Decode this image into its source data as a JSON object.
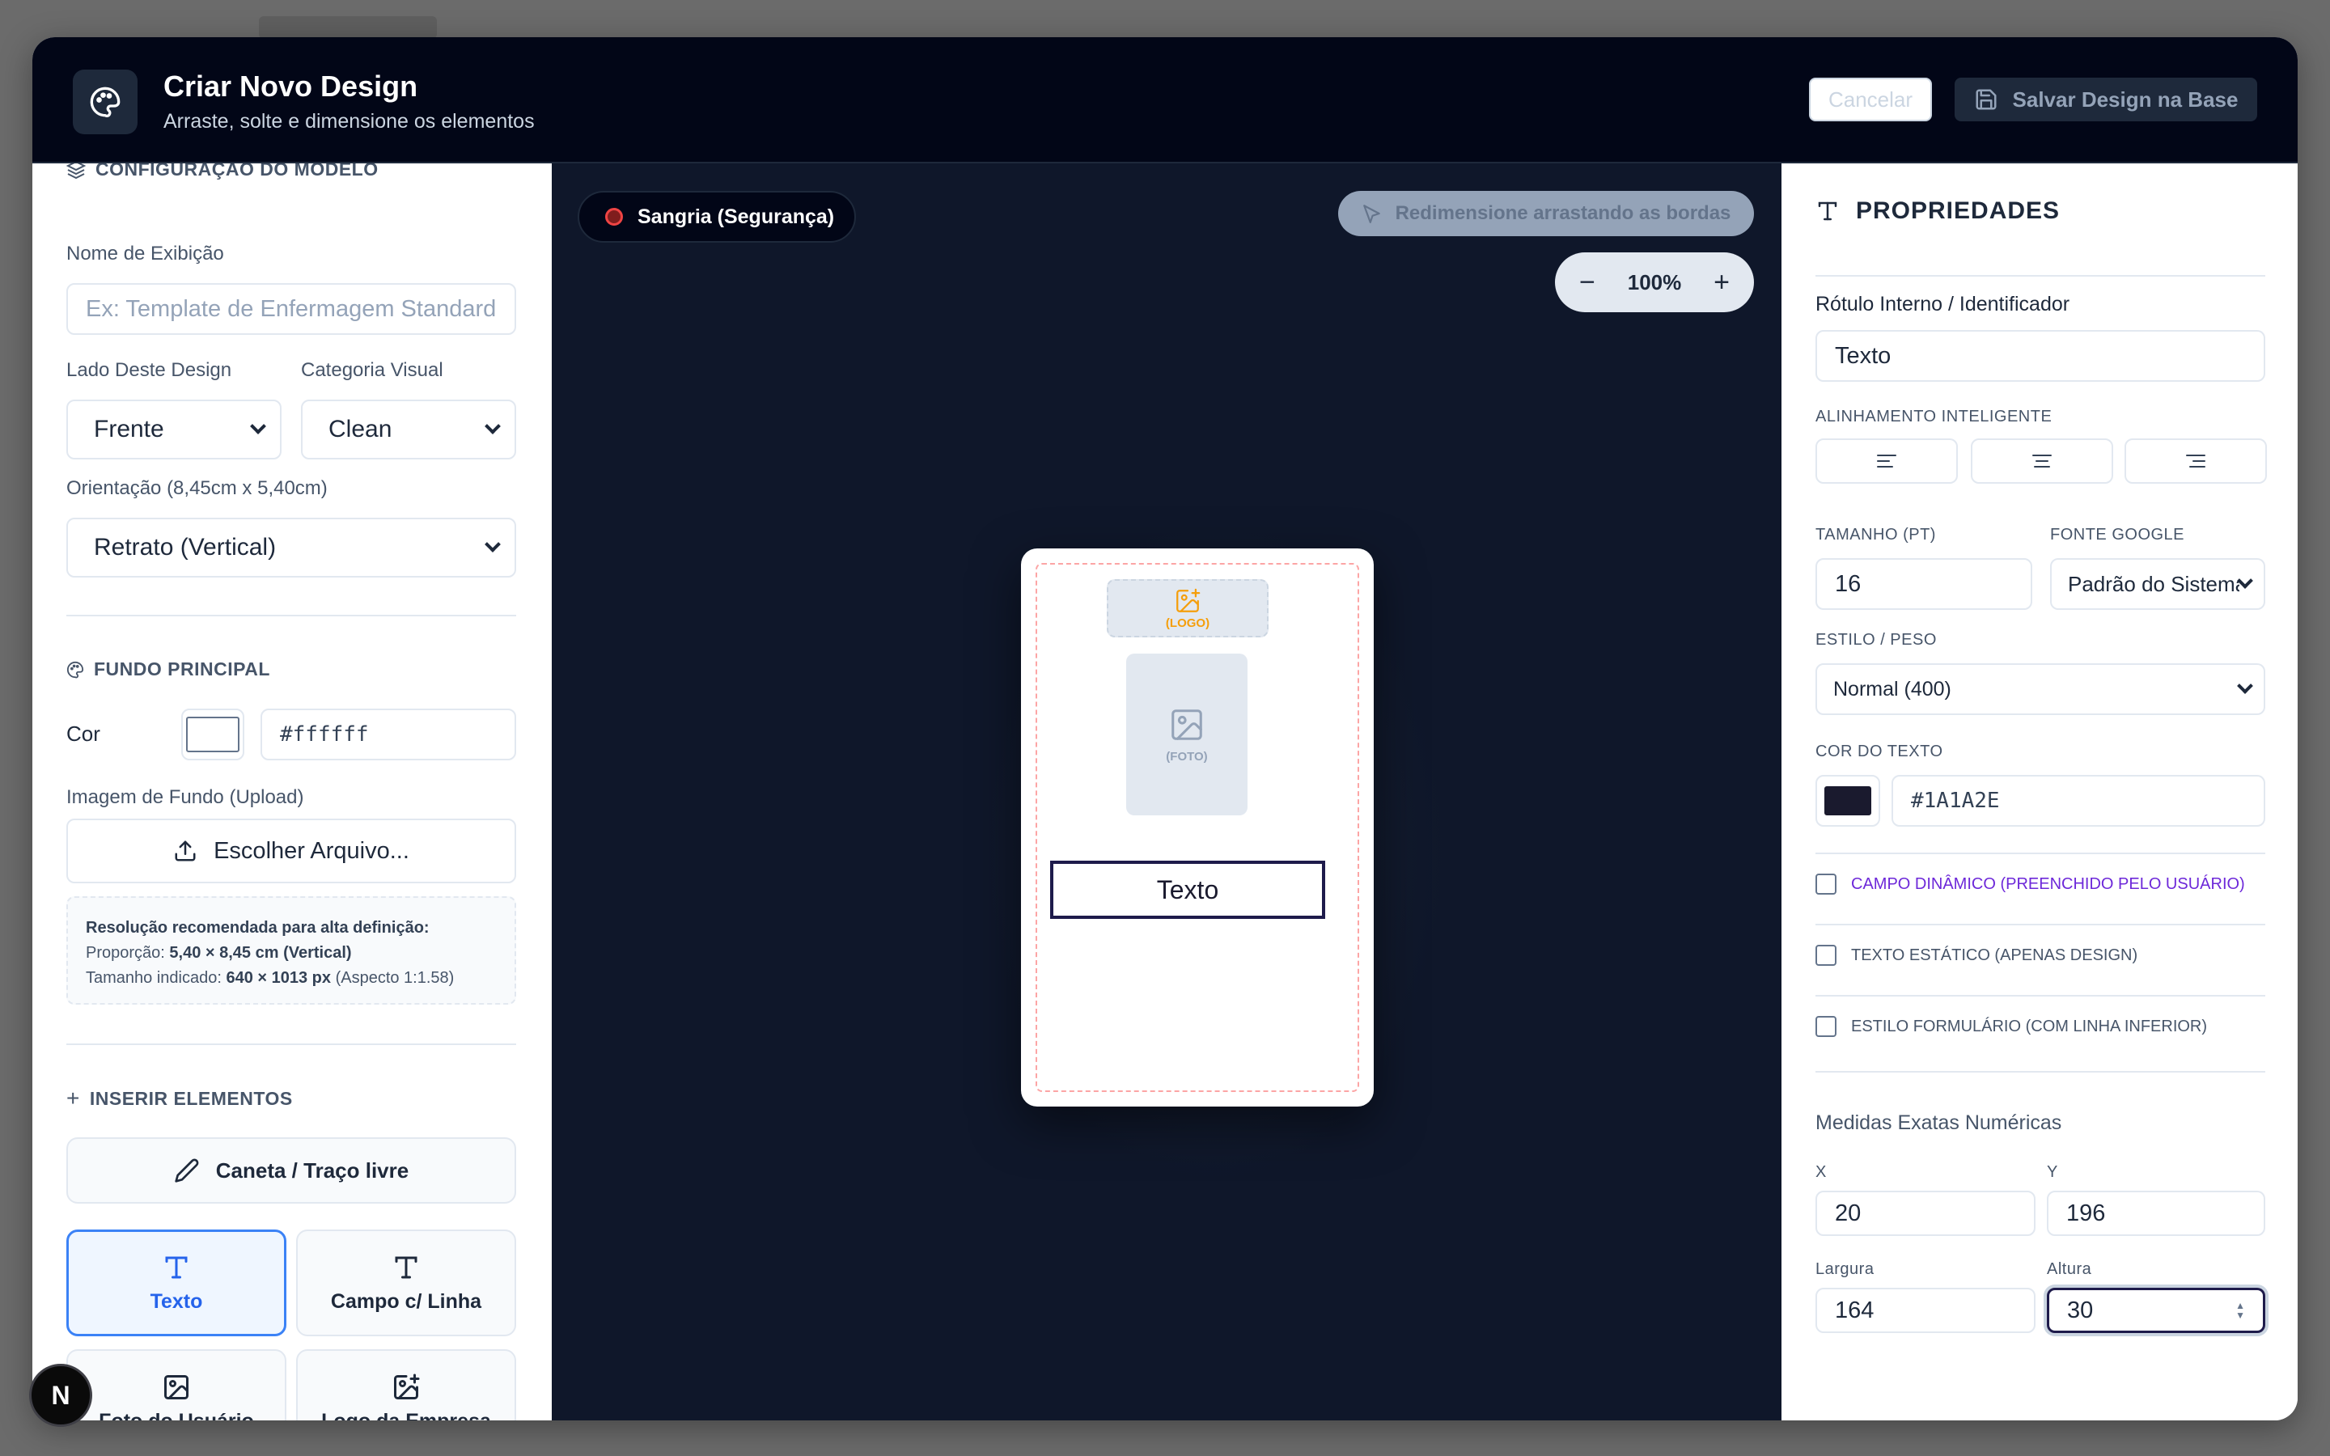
{
  "header": {
    "title": "Criar Novo Design",
    "subtitle": "Arraste, solte e dimensione os elementos",
    "icon": "palette-icon",
    "cancel_label": "Cancelar",
    "save_label": "Salvar Design na Base"
  },
  "left_panel": {
    "model_section_title": "CONFIGURAÇÃO DO MODELO",
    "display_name_label": "Nome de Exibição",
    "display_name_placeholder": "Ex: Template de Enfermagem Standard",
    "side_label": "Lado Deste Design",
    "side_value": "Frente",
    "category_label": "Categoria Visual",
    "category_value": "Clean",
    "orientation_label": "Orientação (8,45cm x 5,40cm)",
    "orientation_value": "Retrato (Vertical)",
    "background_section_title": "FUNDO PRINCIPAL",
    "color_label": "Cor",
    "color_value": "#ffffff",
    "bg_image_label": "Imagem de Fundo (Upload)",
    "upload_label": "Escolher Arquivo...",
    "hint": {
      "title": "Resolução recomendada para alta definição:",
      "ratio_label": "Proporção:",
      "ratio_value": "5,40 × 8,45 cm (Vertical)",
      "size_label": "Tamanho indicado:",
      "size_value": "640 × 1013 px",
      "aspect": "(Aspecto 1:1.58)"
    },
    "insert_section_title": "INSERIR ELEMENTOS",
    "tools": {
      "pen": "Caneta / Traço livre",
      "text": "Texto",
      "field_line": "Campo c/ Linha",
      "user_photo": "Foto do Usuário",
      "company_logo": "Logo da Empresa"
    }
  },
  "canvas": {
    "bleed_label": "Sangria (Segurança)",
    "resize_hint": "Redimensione arrastando as bordas",
    "zoom_level": "100%",
    "zoom_out": "−",
    "zoom_in": "+",
    "logo_placeholder": "(LOGO)",
    "photo_placeholder": "(FOTO)",
    "text_element": "Texto"
  },
  "right_panel": {
    "title": "PROPRIEDADES",
    "internal_label_label": "Rótulo Interno / Identificador",
    "internal_label_value": "Texto",
    "smart_align_label": "ALINHAMENTO INTELIGENTE",
    "size_label": "TAMANHO (PT)",
    "size_value": "16",
    "font_label": "FONTE GOOGLE",
    "font_value": "Padrão do Sistema",
    "style_label": "ESTILO / PESO",
    "style_value": "Normal (400)",
    "text_color_label": "COR DO TEXTO",
    "text_color_value": "#1A1A2E",
    "checkboxes": {
      "dynamic": "CAMPO DINÂMICO (PREENCHIDO PELO USUÁRIO)",
      "static": "TEXTO ESTÁTICO (APENAS DESIGN)",
      "form_style": "ESTILO FORMULÁRIO (COM LINHA INFERIOR)"
    },
    "measures_title": "Medidas Exatas Numéricas",
    "x_label": "X",
    "x_value": "20",
    "y_label": "Y",
    "y_value": "196",
    "width_label": "Largura",
    "width_value": "164",
    "height_label": "Altura",
    "height_value": "30"
  },
  "badge": {
    "label": "N"
  },
  "colors": {
    "header_bg": "#020617",
    "canvas_bg": "#0f172a",
    "accent": "#3b82f6",
    "dynamic_text": "#6d28d9",
    "text_color": "#1A1A2E"
  }
}
